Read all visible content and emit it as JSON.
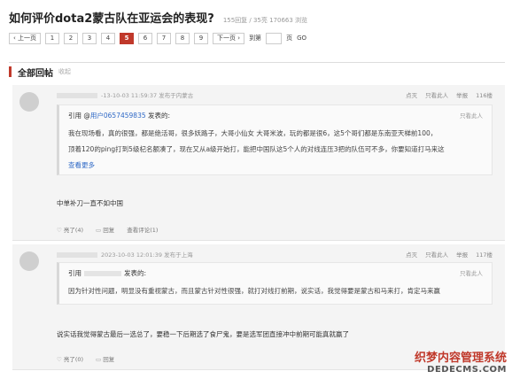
{
  "header": {
    "title": "如何评价dota2蒙古队在亚运会的表现?",
    "stats": "155回复 / 35亮 170663 浏览"
  },
  "pager": {
    "prev": "‹ 上一页",
    "pages": [
      "1",
      "2",
      "3",
      "4",
      "5",
      "6",
      "7",
      "8",
      "9"
    ],
    "active": "5",
    "next": "下一页 ›",
    "goto_label": "到第",
    "page_label": "页",
    "go": "GO"
  },
  "section": {
    "title": "全部回帖",
    "sub": "收起"
  },
  "post1": {
    "time": "-13-10-03 11:59:37",
    "source": "发布于内蒙古",
    "actions": [
      "点灭",
      "只看此人",
      "举报",
      "116楼"
    ],
    "quote": {
      "prefix": "引用 @",
      "user": "用户0657459835",
      "suffix": "发表的:",
      "right": "只看此人",
      "lines": [
        "我在现场看，真的很强，都是绝活哥，很多妖路子，大哥小仙女 大哥米波，玩的都是很6，这5个哥们都是东南亚天梯前100，",
        "顶着120的ping打到5级杞名额凑了，现在又从a级开始打，能把中国队这5个人的对线连压3把的队伍可不多，你要知道打马来这"
      ],
      "see_more": "查看更多"
    },
    "body": "中单补刀一直不如中国",
    "footer": {
      "like": "亮了(4)",
      "reply": "回复",
      "view": "查看评论(1)"
    }
  },
  "post2": {
    "time": "2023-10-03 12:01:39",
    "source": "发布于上海",
    "actions": [
      "点灭",
      "只看此人",
      "举报",
      "117楼"
    ],
    "quote": {
      "prefix": "引用",
      "suffix": "发表的:",
      "right": "只看此人",
      "lines": [
        "因为针对性问题，明显没有重视蒙古，而且蒙古针对性很强，就打对线打前期，说实话，我觉得要是蒙古和马来打，肯定马来赢"
      ]
    },
    "body": "说实话我觉得蒙古最后一选总了，要稳一下后期选了食尸鬼，要是选军团直接冲中前期可能真就赢了",
    "footer": {
      "like": "亮了(0)",
      "reply": "回复"
    }
  },
  "watermark": {
    "line1": "织梦内容管理系统",
    "line2": "DEDECMS.COM"
  }
}
